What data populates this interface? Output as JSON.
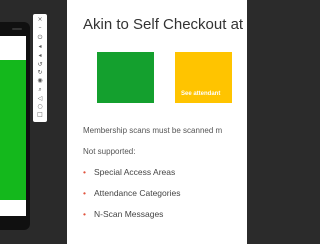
{
  "toolbar": {
    "icons": [
      "close-icon",
      "minimize-icon",
      "power-icon",
      "volume-up-icon",
      "volume-down-icon",
      "rotate-left-icon",
      "rotate-right-icon",
      "camera-icon",
      "zoom-icon",
      "back-icon",
      "home-icon",
      "overview-icon",
      "more-icon"
    ],
    "glyphs": [
      "×",
      "–",
      "⏻",
      "◂",
      "◂",
      "↺",
      "↻",
      "◉",
      "⌕",
      "◁",
      "○",
      "□",
      "⋯"
    ]
  },
  "slide": {
    "title": "Akin to Self Checkout at",
    "swatches": [
      {
        "color": "#14a02e",
        "label": ""
      },
      {
        "color": "#ffc400",
        "label": "See attendant"
      }
    ],
    "line1": "Membership scans must be scanned m",
    "line2": "Not supported:",
    "bullets": [
      "Special Access Areas",
      "Attendance Categories",
      "N-Scan Messages"
    ],
    "bullet_color": "#e0533e"
  }
}
